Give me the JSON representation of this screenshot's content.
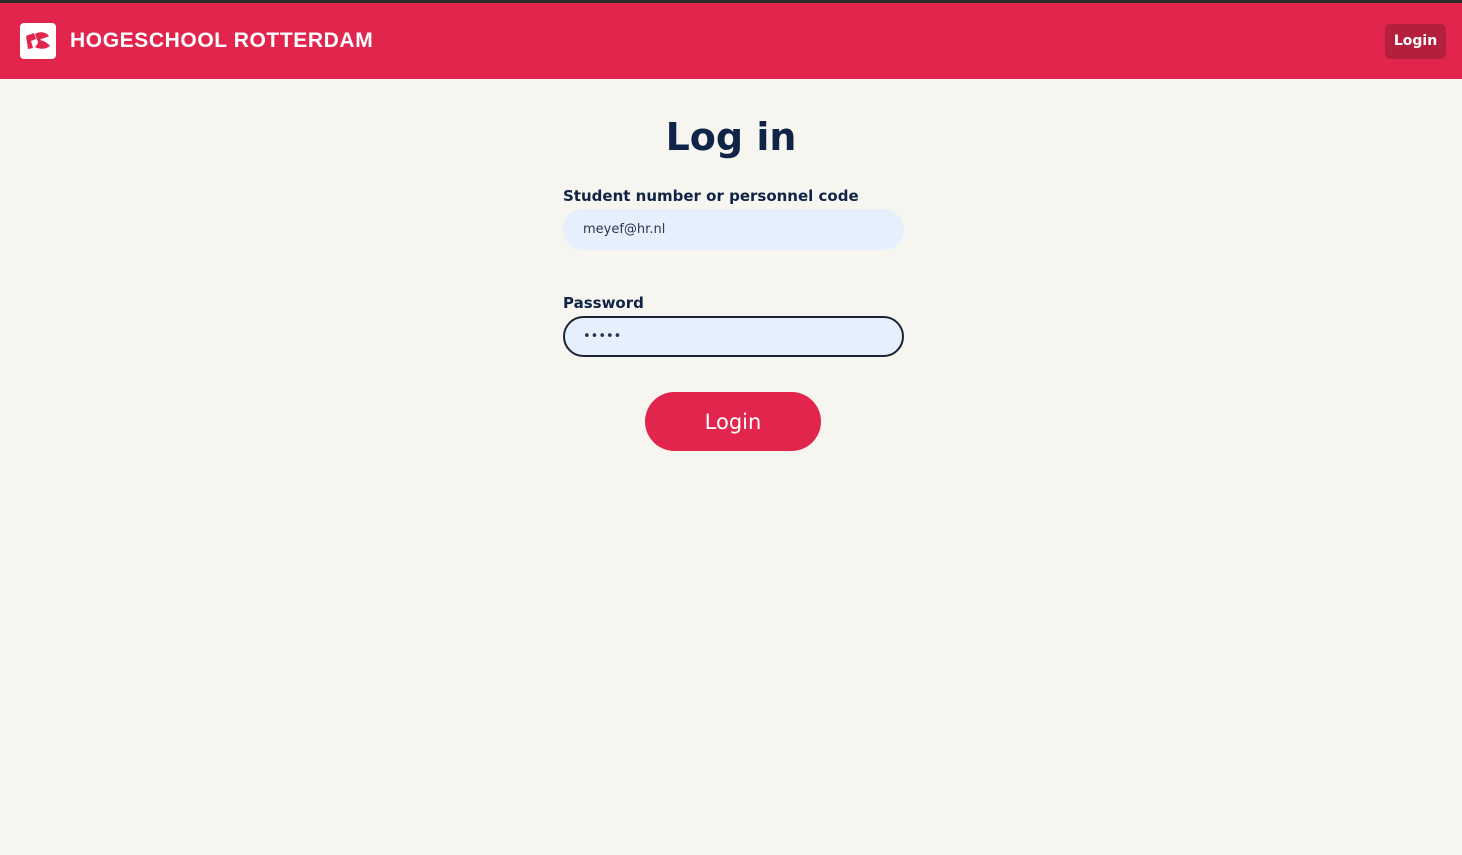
{
  "header": {
    "brand_name": "HOGESCHOOL ROTTERDAM",
    "login_label": "Login",
    "brand_color": "#e2254c",
    "logo_icon": "hr-logo-icon"
  },
  "page": {
    "title": "Log in"
  },
  "form": {
    "username_label": "Student number or personnel code",
    "username_value": "meyef@hr.nl",
    "password_label": "Password",
    "password_value": "•••••",
    "submit_label": "Login"
  }
}
